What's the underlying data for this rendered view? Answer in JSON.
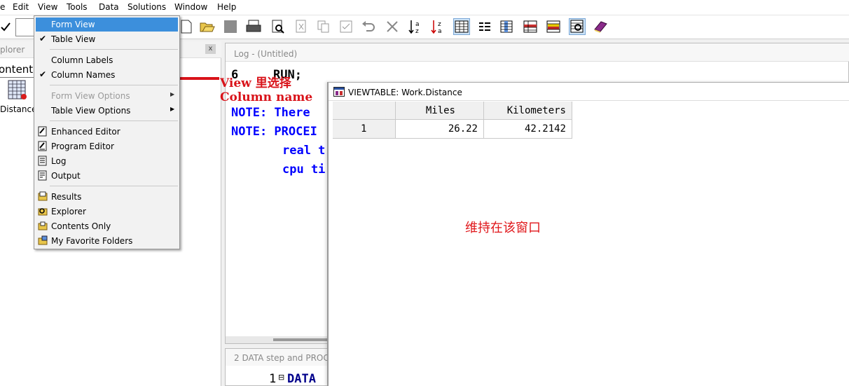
{
  "menubar": [
    "e",
    "Edit",
    "View",
    "Tools",
    "Data",
    "Solutions",
    "Window",
    "Help"
  ],
  "explorer": {
    "title": "plorer",
    "close": "x",
    "tab": "ontent",
    "library_item": "Distance"
  },
  "log": {
    "title": "Log - (Untitled)",
    "lines": [
      {
        "num": "6",
        "text": "RUN;"
      },
      {
        "num": "",
        "text": "NOTE: There"
      },
      {
        "num": "",
        "text": "NOTE: PROCEI"
      },
      {
        "num": "",
        "text": "real t"
      },
      {
        "num": "",
        "text": "cpu ti"
      }
    ]
  },
  "program": {
    "title": "2 DATA step and PROC",
    "line_num": "1",
    "fold": "⊟",
    "text": "DATA"
  },
  "viewtable": {
    "title": "VIEWTABLE: Work.Distance",
    "columns": [
      "Miles",
      "Kilometers"
    ],
    "rows": [
      {
        "row": "1",
        "miles": "26.22",
        "km": "42.2142"
      }
    ],
    "note": "维持在该窗口"
  },
  "view_menu": {
    "items": {
      "form_view": "Form View",
      "table_view": "Table View",
      "column_labels": "Column Labels",
      "column_names": "Column Names",
      "form_view_options": "Form View Options",
      "table_view_options": "Table View Options",
      "enhanced_editor": "Enhanced Editor",
      "program_editor": "Program Editor",
      "log": "Log",
      "output": "Output",
      "results": "Results",
      "explorer": "Explorer",
      "contents_only": "Contents Only",
      "my_favorite_folders": "My Favorite Folders"
    },
    "checkmark": "✔",
    "submenu_arrow": "▶"
  },
  "annotation": {
    "line1": "View 里选择",
    "line2": "Column name"
  },
  "colors": {
    "menu_highlight": "#3c8fdc",
    "code_blue": "#0000ff",
    "annotation_red": "#d9131a"
  }
}
